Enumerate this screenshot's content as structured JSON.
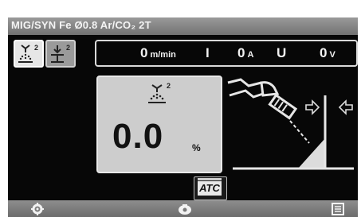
{
  "header": {
    "title": "MIG/SYN Fe Ø0.8 Ar/CO₂ 2T"
  },
  "readout": {
    "wire_speed_value": "0",
    "wire_speed_unit": "m/min",
    "current_symbol": "I",
    "current_value": "0",
    "current_unit": "A",
    "voltage_symbol": "U",
    "voltage_value": "0",
    "voltage_unit": "V"
  },
  "mode_buttons": {
    "left_superscript": "2",
    "right_superscript": "2"
  },
  "parameter": {
    "superscript": "2",
    "value": "0.0",
    "unit": "%"
  },
  "atc": {
    "label": "ATC"
  },
  "icons": [
    "spray-arc-2-icon",
    "short-arc-2-icon",
    "torch-icon",
    "arrow-right-icon",
    "arrow-left-icon",
    "settings-gear-icon",
    "home-icon",
    "menu-icon"
  ],
  "colors": {
    "background": "#070707",
    "panel": "#cdcdcd",
    "titlebar": "#8a8a8a"
  }
}
